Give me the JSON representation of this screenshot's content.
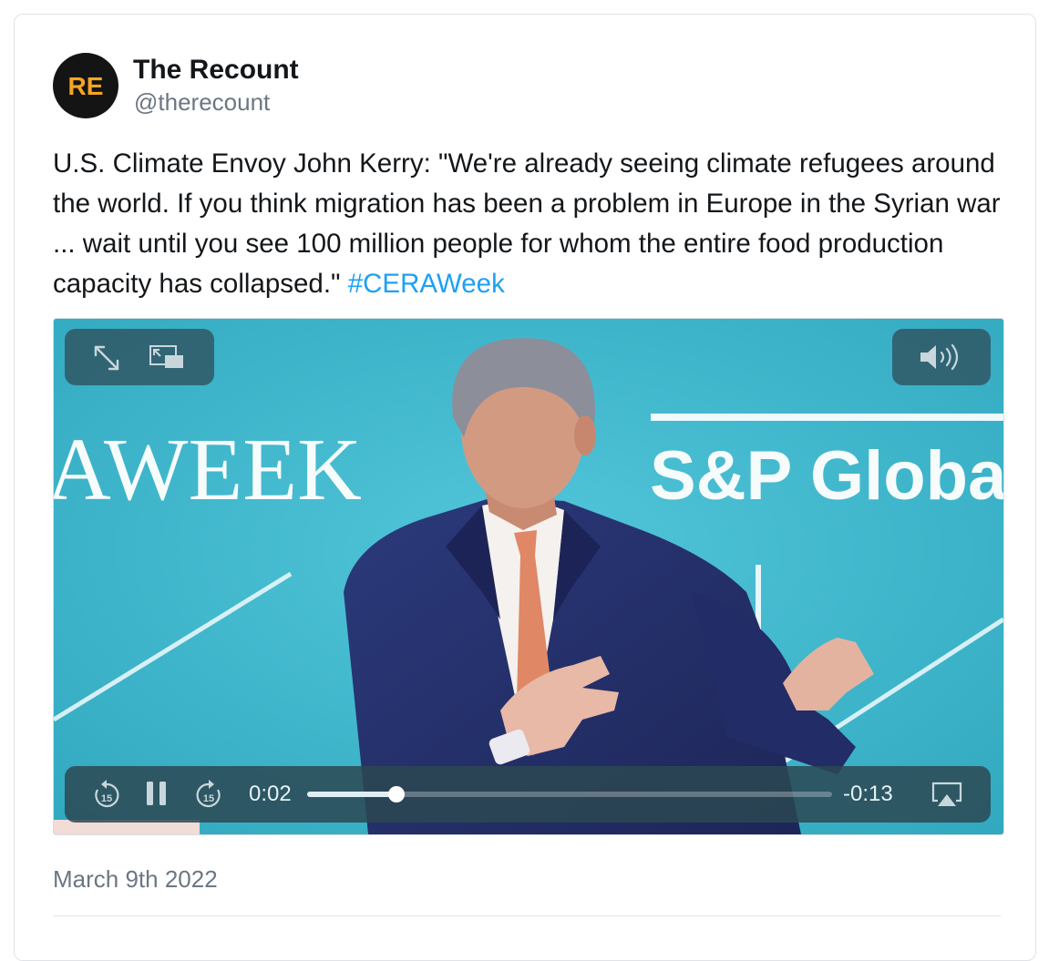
{
  "tweet": {
    "author_name": "The Recount",
    "author_handle": "@therecount",
    "avatar_monogram": "RE",
    "avatar_colors": {
      "background": "#141414",
      "monogram": "#f5a623"
    },
    "text": "U.S. Climate Envoy John Kerry: \"We're already seeing climate refugees around the world. If you think migration has been a problem in Europe in the Syrian war ... wait until you see 100 million people for whom the entire food production capacity has collapsed.\" ",
    "hashtag": "#CERAWeek",
    "date": "March 9th 2022"
  },
  "video": {
    "backdrop_text_left": "AWEEK",
    "backdrop_text_right": "S&P Globa",
    "elapsed": "0:02",
    "remaining": "-0:13",
    "progress_fraction": 0.17,
    "icons": {
      "fullscreen": "expand-arrows-icon",
      "pip": "picture-in-picture-icon",
      "volume": "speaker-volume-icon",
      "skip_back": "skip-back-15-icon",
      "pause": "pause-icon",
      "skip_forward": "skip-forward-15-icon",
      "airplay": "airplay-icon"
    },
    "skip_seconds": "15"
  },
  "colors": {
    "hashtag": "#1da1f2",
    "video_background": "#3fb4ca",
    "suit": "#25306b",
    "tie": "#e08766"
  }
}
